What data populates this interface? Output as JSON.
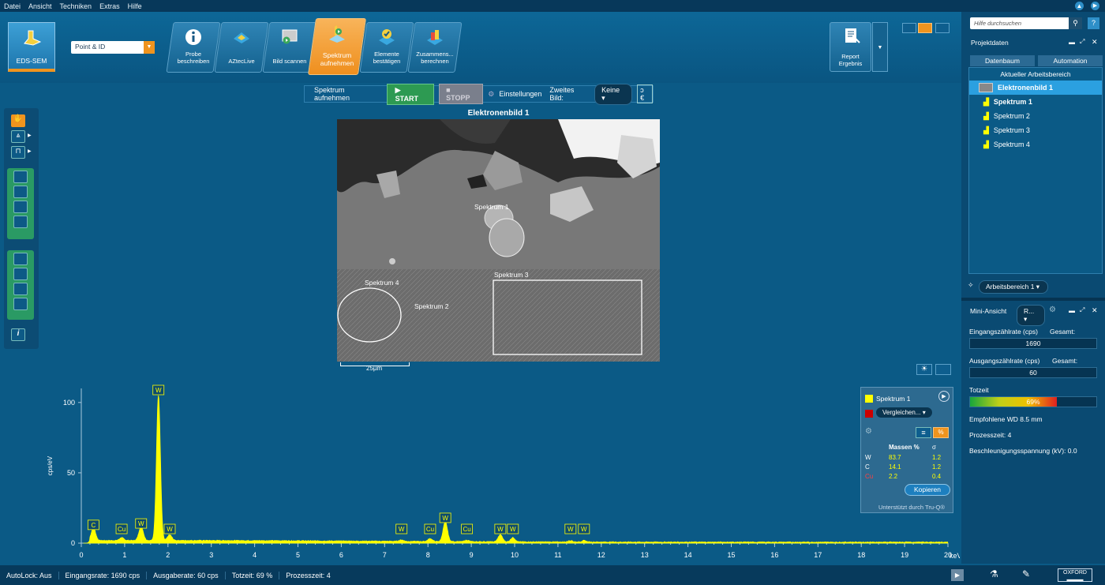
{
  "menu": [
    "Datei",
    "Ansicht",
    "Techniken",
    "Extras",
    "Hilfe"
  ],
  "ribbon": {
    "app_button": "EDS-SEM",
    "mode_dropdown": "Point & ID",
    "steps": [
      "Probe beschreiben",
      "AZtecLive",
      "Bild scannen",
      "Spektrum aufnehmen",
      "Elemente bestätigen",
      "Zusammens... berechnen"
    ],
    "report": "Report Ergebnis"
  },
  "acq": {
    "label": "Spektrum aufnehmen",
    "start": "START",
    "stop": "STOPP",
    "settings": "Einstellungen",
    "second_label": "Zweites Bild:",
    "second_value": "Keine"
  },
  "image": {
    "title": "Elektronenbild 1",
    "scalebar": "25µm",
    "labels": [
      "Spektrum 1",
      "Spektrum 2",
      "Spektrum 3",
      "Spektrum 4"
    ]
  },
  "legend": {
    "series1": "Spektrum 1",
    "compare": "Vergleichen...",
    "col_mass": "Massen %",
    "col_sigma": "σ",
    "rows": [
      {
        "el": "W",
        "mass": "83.7",
        "sigma": "1.2"
      },
      {
        "el": "C",
        "mass": "14.1",
        "sigma": "1.2"
      },
      {
        "el": "Cu",
        "mass": "2.2",
        "sigma": "0.4"
      }
    ],
    "copy": "Kopieren",
    "footer": "Unterstützt durch Tru-Q®"
  },
  "right": {
    "search_placeholder": "Hilfe durchsuchen",
    "projekt": "Projektdaten",
    "tab1": "Datenbaum",
    "tab2": "Automation",
    "workspace": "Aktueller Arbeitsbereich",
    "tree": [
      "Elektronenbild 1",
      "Spektrum 1",
      "Spektrum 2",
      "Spektrum 3",
      "Spektrum 4"
    ],
    "arbeitsbereich": "Arbeitsbereich 1",
    "mini": "Mini-Ansicht",
    "mini_dd": "R...",
    "in_label": "Eingangszählrate (cps)",
    "in_total": "Gesamt:",
    "in_value": "1690",
    "out_label": "Ausgangszählrate (cps)",
    "out_total": "Gesamt:",
    "out_value": "60",
    "dead_label": "Totzeit",
    "dead_value": "69%",
    "wd": "Empfohlene WD 8.5 mm",
    "proc": "Prozesszeit: 4",
    "accel": "Beschleunigungsspannung (kV): 0.0"
  },
  "status": [
    "AutoLock: Aus",
    "Eingangsrate: 1690 cps",
    "Ausgaberate: 60 cps",
    "Totzeit: 69 %",
    "Prozesszeit: 4"
  ],
  "chart_data": {
    "type": "line",
    "xlabel": "keV",
    "ylabel": "cps/eV",
    "xlim": [
      0,
      20
    ],
    "ylim": [
      0,
      110
    ],
    "xticks": [
      0,
      1,
      2,
      3,
      4,
      5,
      6,
      7,
      8,
      9,
      10,
      11,
      12,
      13,
      14,
      15,
      16,
      17,
      18,
      19,
      20
    ],
    "yticks": [
      0,
      50,
      100
    ],
    "peaks": [
      {
        "x": 0.28,
        "y": 9
      },
      {
        "x": 0.93,
        "y": 2
      },
      {
        "x": 1.38,
        "y": 10
      },
      {
        "x": 1.78,
        "y": 103
      },
      {
        "x": 2.04,
        "y": 4
      },
      {
        "x": 7.39,
        "y": 1
      },
      {
        "x": 8.05,
        "y": 2
      },
      {
        "x": 8.4,
        "y": 14
      },
      {
        "x": 8.9,
        "y": 1
      },
      {
        "x": 9.67,
        "y": 5
      },
      {
        "x": 9.96,
        "y": 3
      },
      {
        "x": 11.29,
        "y": 1
      },
      {
        "x": 11.6,
        "y": 1
      }
    ],
    "line_labels": [
      {
        "x": 0.28,
        "el": "C"
      },
      {
        "x": 0.93,
        "el": "Cu"
      },
      {
        "x": 1.38,
        "el": "W"
      },
      {
        "x": 1.78,
        "el": "W"
      },
      {
        "x": 2.04,
        "el": "W"
      },
      {
        "x": 7.39,
        "el": "W"
      },
      {
        "x": 8.05,
        "el": "Cu"
      },
      {
        "x": 8.4,
        "el": "W"
      },
      {
        "x": 8.9,
        "el": "Cu"
      },
      {
        "x": 9.67,
        "el": "W"
      },
      {
        "x": 9.96,
        "el": "W"
      },
      {
        "x": 11.29,
        "el": "W"
      },
      {
        "x": 11.6,
        "el": "W"
      }
    ],
    "series": [
      {
        "name": "Spektrum 1",
        "color": "#ffff00"
      }
    ]
  }
}
